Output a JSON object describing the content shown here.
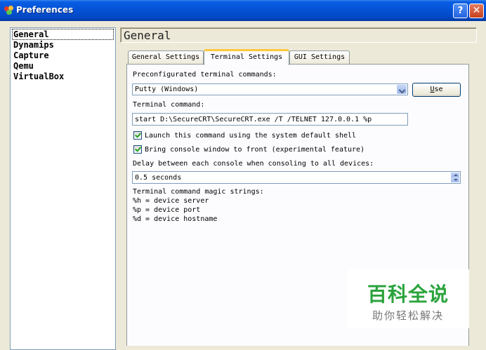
{
  "window": {
    "title": "Preferences",
    "help_label": "?",
    "close_label": "✕"
  },
  "nav": {
    "items": [
      "General",
      "Dynamips",
      "Capture",
      "Qemu",
      "VirtualBox"
    ],
    "selected": "General"
  },
  "header": {
    "title": "General"
  },
  "tabs": [
    {
      "label": "General Settings",
      "active": false
    },
    {
      "label": "Terminal Settings",
      "active": true
    },
    {
      "label": "GUI Settings",
      "active": false
    }
  ],
  "terminal": {
    "preconfig_label": "Preconfigurated terminal commands:",
    "preconfig_value": "Putty (Windows)",
    "use_button": "se",
    "use_button_mnemonic": "U",
    "command_label": "Terminal command:",
    "command_value": "start D:\\SecureCRT\\SecureCRT.exe /T /TELNET 127.0.0.1 %p",
    "checkboxes": [
      {
        "label": "Launch this command using the system default shell",
        "checked": true
      },
      {
        "label": "Bring console window to front (experimental feature)",
        "checked": true
      }
    ],
    "delay_label": "Delay between each console when consoling to all devices:",
    "delay_value": "0.5 seconds",
    "magic_title": "Terminal command magic strings:",
    "magic_lines": [
      "%h = device server",
      "%p = device port",
      "%d = device hostname"
    ]
  },
  "watermark": {
    "title": "百科全说",
    "subtitle": "助你轻松解决"
  },
  "colors": {
    "titlebar": "#0454d8",
    "checkmark": "#21a121",
    "watermark": "#2aa33c",
    "active_tab_accent": "#ffc83c"
  }
}
